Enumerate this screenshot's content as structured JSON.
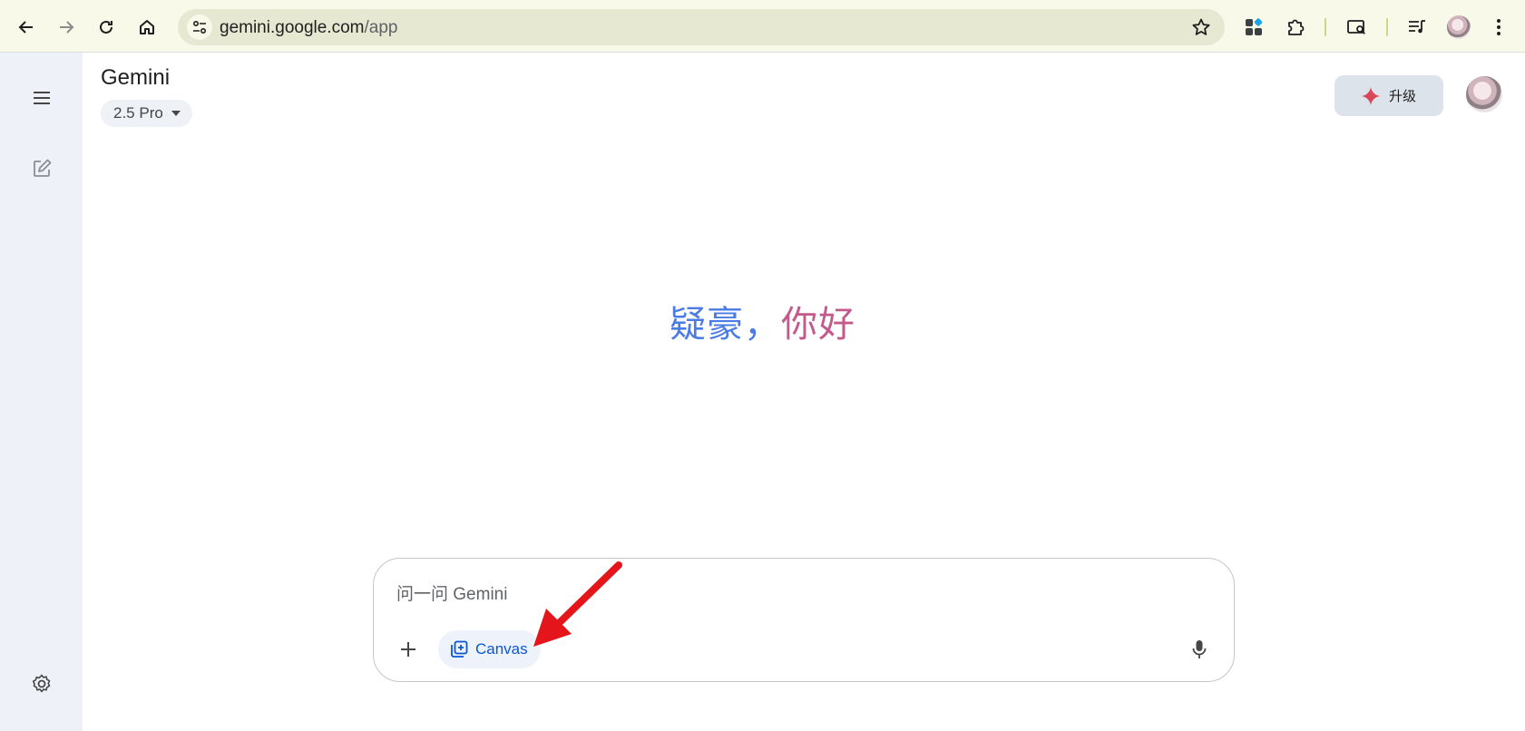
{
  "browser": {
    "url_host": "gemini.google.com",
    "url_path": "/app"
  },
  "header": {
    "title": "Gemini",
    "model": "2.5 Pro",
    "upgrade_label": "升级"
  },
  "greeting": {
    "name": "疑豪，",
    "hello": "你好"
  },
  "composer": {
    "placeholder": "问一问 Gemini",
    "canvas_label": "Canvas"
  },
  "colors": {
    "accent": "#0b57d0",
    "annotation_arrow": "#e5161b",
    "upgrade_spark": "#d9475a"
  }
}
